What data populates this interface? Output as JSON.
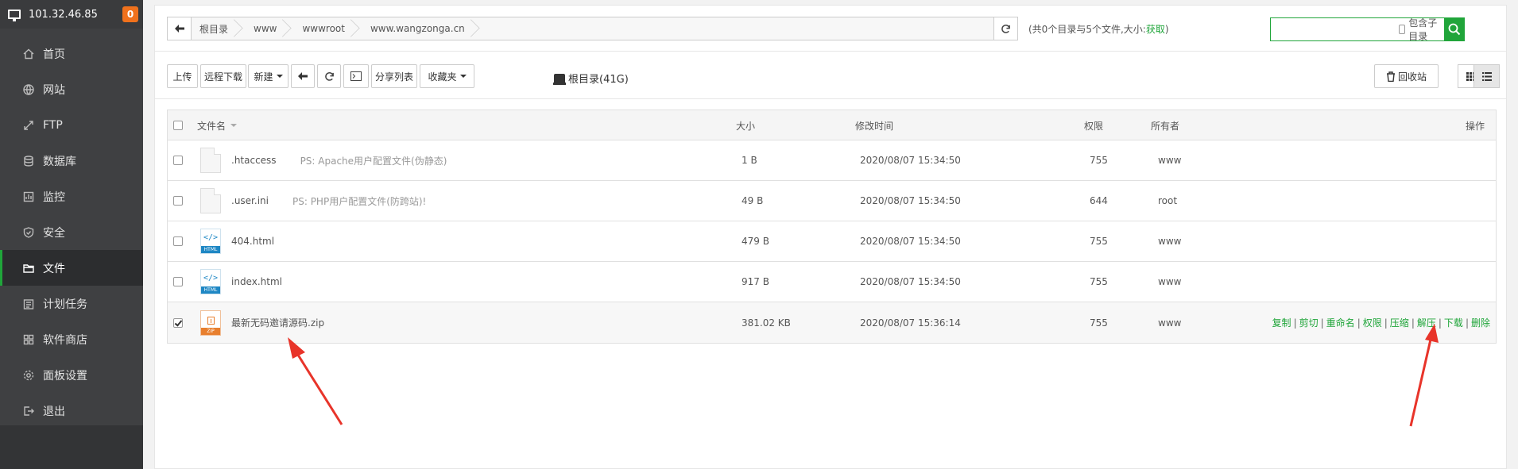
{
  "sidebar": {
    "server_ip": "101.32.46.85",
    "badge": "0",
    "items": [
      {
        "label": "首页",
        "icon": "home-icon"
      },
      {
        "label": "网站",
        "icon": "globe-icon"
      },
      {
        "label": "FTP",
        "icon": "ftp-icon"
      },
      {
        "label": "数据库",
        "icon": "database-icon"
      },
      {
        "label": "监控",
        "icon": "monitor-icon"
      },
      {
        "label": "安全",
        "icon": "shield-icon"
      },
      {
        "label": "文件",
        "icon": "folder-icon",
        "active": true
      },
      {
        "label": "计划任务",
        "icon": "task-icon"
      },
      {
        "label": "软件商店",
        "icon": "apps-icon"
      },
      {
        "label": "面板设置",
        "icon": "settings-icon"
      },
      {
        "label": "退出",
        "icon": "logout-icon"
      }
    ]
  },
  "breadcrumb": [
    "根目录",
    "www",
    "wwwroot",
    "www.wangzonga.cn"
  ],
  "summary": {
    "text": "(共0个目录与5个文件,大小:",
    "fetch": "获取",
    "close": ")"
  },
  "search": {
    "placeholder": "",
    "include_sub_label": "包含子目录"
  },
  "toolbar": {
    "upload": "上传",
    "remote_download": "远程下载",
    "new": "新建",
    "share_list": "分享列表",
    "favorites": "收藏夹",
    "disk": "根目录(41G)",
    "recycle": "回收站"
  },
  "table": {
    "headers": {
      "name": "文件名",
      "size": "大小",
      "mtime": "修改时间",
      "perm": "权限",
      "owner": "所有者",
      "ops": "操作"
    },
    "rows": [
      {
        "name": ".htaccess",
        "note": "PS: Apache用户配置文件(伪静态)",
        "size": "1 B",
        "mtime": "2020/08/07 15:34:50",
        "perm": "755",
        "owner": "www",
        "type": "blank",
        "checked": false
      },
      {
        "name": ".user.ini",
        "note": "PS: PHP用户配置文件(防跨站)!",
        "size": "49 B",
        "mtime": "2020/08/07 15:34:50",
        "perm": "644",
        "owner": "root",
        "type": "blank",
        "checked": false
      },
      {
        "name": "404.html",
        "note": "",
        "size": "479 B",
        "mtime": "2020/08/07 15:34:50",
        "perm": "755",
        "owner": "www",
        "type": "html",
        "checked": false
      },
      {
        "name": "index.html",
        "note": "",
        "size": "917 B",
        "mtime": "2020/08/07 15:34:50",
        "perm": "755",
        "owner": "www",
        "type": "html",
        "checked": false
      },
      {
        "name": "最新无码邀请源码.zip",
        "note": "",
        "size": "381.02 KB",
        "mtime": "2020/08/07 15:36:14",
        "perm": "755",
        "owner": "www",
        "type": "zip",
        "checked": true
      }
    ],
    "row_actions": [
      "复制",
      "剪切",
      "重命名",
      "权限",
      "压缩",
      "解压",
      "下载",
      "删除"
    ],
    "file_label_html": "HTML",
    "file_label_zip": "ZIP"
  },
  "colors": {
    "accent": "#20a53a",
    "sidebar": "#3f4042",
    "badge": "#f0711c",
    "arrow": "#e8342a"
  }
}
